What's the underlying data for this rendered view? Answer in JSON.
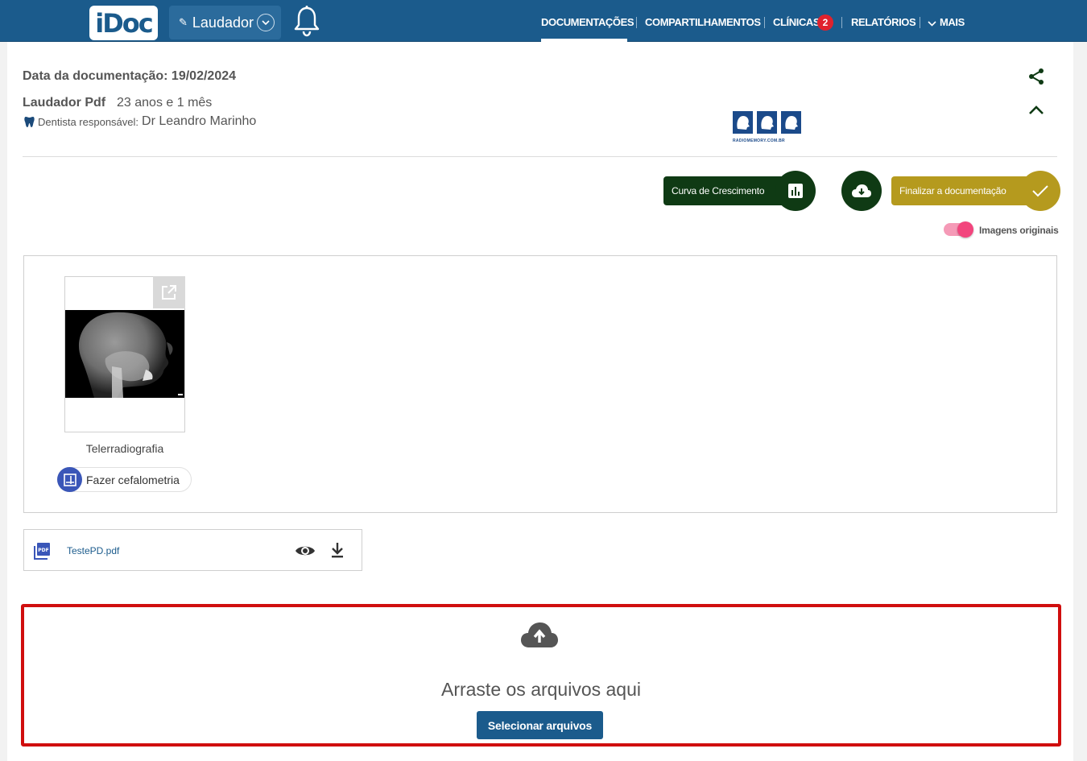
{
  "header": {
    "logo_text": "iDoc",
    "role_label": "Laudador",
    "nav": [
      {
        "label": "DOCUMENTAÇÕES",
        "active": true
      },
      {
        "label": "COMPARTILHAMENTOS"
      },
      {
        "label": "CLÍNICAS",
        "badge": "2"
      },
      {
        "label": "RELATÓRIOS"
      },
      {
        "label": "MAIS"
      }
    ]
  },
  "documentation": {
    "date_text": "Data da documentação: 19/02/2024",
    "type": "Laudador Pdf",
    "age": "23 anos e 1 mês",
    "dentist_label": "Dentista responsável:",
    "dentist_name": "Dr Leandro Marinho",
    "clinic_logo_text": "RADIOMEMORY.COM.BR"
  },
  "actions": {
    "growth_curve_label": "Curva de Crescimento",
    "finalize_label": "Finalizar a documentação",
    "original_images_label": "Imagens originais",
    "original_images_on": true
  },
  "images": [
    {
      "label": "Telerradiografia",
      "action_label": "Fazer cefalometria"
    }
  ],
  "files": [
    {
      "name": "TestePD.pdf"
    }
  ],
  "upload": {
    "drop_text": "Arraste os arquivos aqui",
    "select_label": "Selecionar arquivos"
  },
  "colors": {
    "header_bg": "#1b5b8c",
    "dark_green": "#0f3a14",
    "gold": "#b59a1e",
    "highlight_red": "#d00e0e",
    "toggle_pink": "#f2457d"
  }
}
